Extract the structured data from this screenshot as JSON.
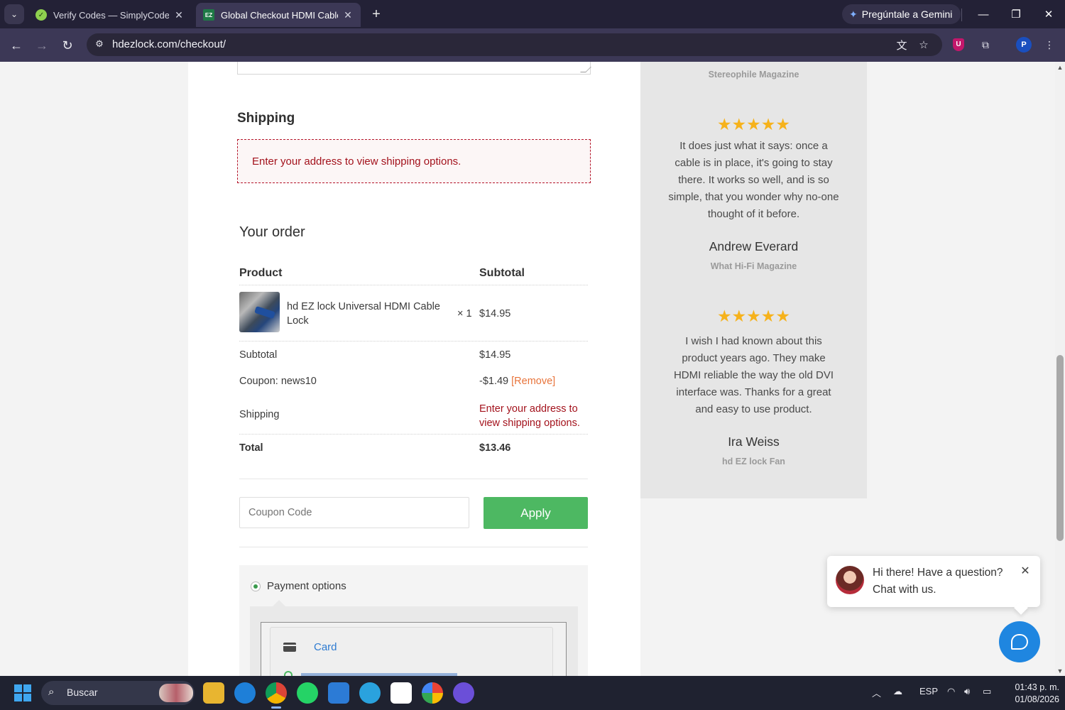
{
  "browser": {
    "tabs": [
      {
        "title": "Verify Codes — SimplyCodes",
        "active": false
      },
      {
        "title": "Global Checkout HDMI Cable lo",
        "active": true
      }
    ],
    "gemini_label": "Pregúntale a Gemini",
    "url": "hdezlock.com/checkout/",
    "profile_initial": "P",
    "extension_badge": "U"
  },
  "checkout": {
    "shipping_heading": "Shipping",
    "shipping_notice": "Enter your address to view shipping options.",
    "order_heading": "Your order",
    "columns": {
      "product": "Product",
      "subtotal": "Subtotal"
    },
    "item": {
      "name": "hd EZ lock Universal HDMI Cable Lock",
      "qty": "× 1",
      "price": "$14.95"
    },
    "totals": {
      "subtotal_label": "Subtotal",
      "subtotal_value": "$14.95",
      "coupon_label": "Coupon: news10",
      "coupon_value": "-$1.49",
      "coupon_remove": "[Remove]",
      "shipping_label": "Shipping",
      "shipping_value": "Enter your address to view shipping options.",
      "total_label": "Total",
      "total_value": "$13.46"
    },
    "coupon_placeholder": "Coupon Code",
    "apply_label": "Apply",
    "payment_label": "Payment options",
    "card_label": "Card"
  },
  "reviews": {
    "top_source": "Stereophile Magazine",
    "items": [
      {
        "stars": "★★★★★",
        "rating": 5,
        "text": "It does just what it says: once a cable is in place, it's going to stay there. It works so well, and is so simple, that you wonder why no-one thought of it before.",
        "author": "Andrew Everard",
        "source": "What Hi-Fi Magazine"
      },
      {
        "stars": "★★★★★",
        "rating": 5,
        "text": "I wish I had known about this product years ago. They make HDMI reliable the way the old DVI interface was. Thanks for a great and easy to use product.",
        "author": "Ira Weiss",
        "source": "hd EZ lock Fan"
      }
    ]
  },
  "chat": {
    "message": "Hi there! Have a question? Chat with us."
  },
  "taskbar": {
    "search_label": "Buscar",
    "lang": "ESP",
    "time": "01:43 p. m.",
    "date": "01/08/2026"
  },
  "colors": {
    "accent_green": "#4db862",
    "error_red": "#a3121c",
    "star": "#f6b21b",
    "chat_blue": "#1f86e0"
  }
}
